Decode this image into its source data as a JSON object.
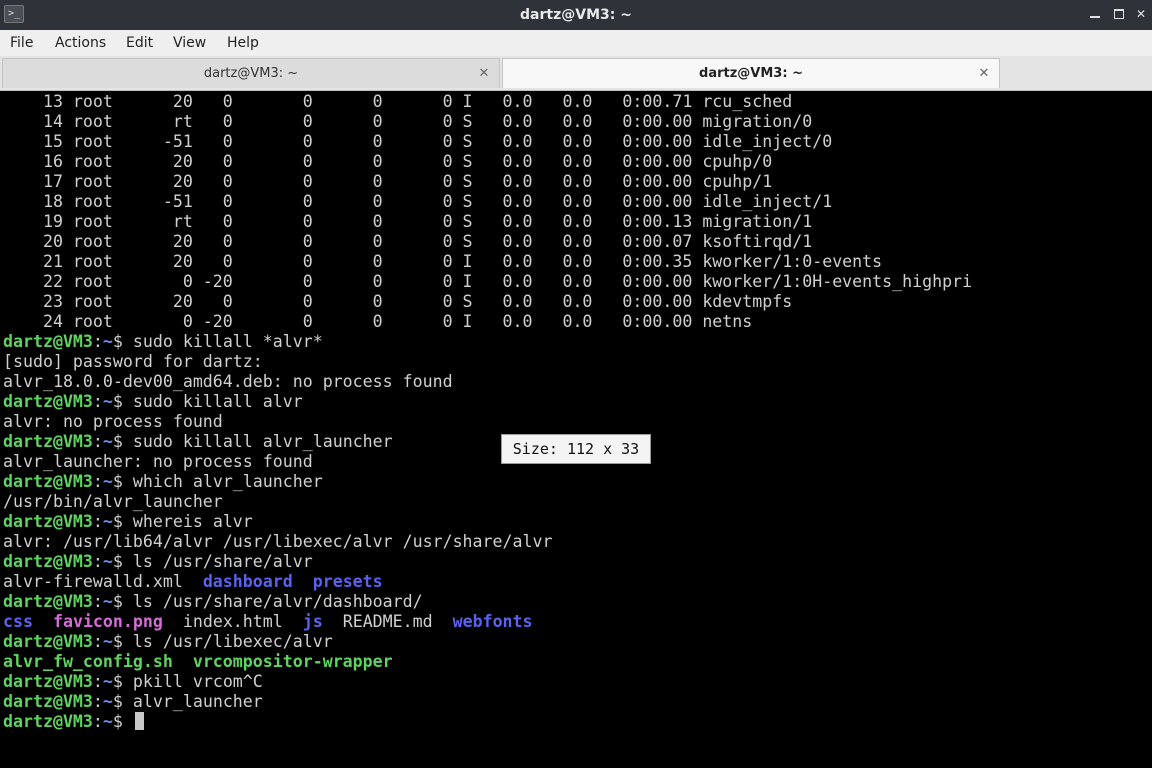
{
  "window": {
    "title": "dartz@VM3: ~",
    "app_icon": ">_"
  },
  "menu": {
    "items": [
      "File",
      "Actions",
      "Edit",
      "View",
      "Help"
    ]
  },
  "tabs": [
    {
      "label": "dartz@VM3: ~",
      "active": false
    },
    {
      "label": "dartz@VM3: ~",
      "active": true
    }
  ],
  "terminal": {
    "size_tooltip": "Size: 112 x 33",
    "lines": [
      [
        {
          "t": "    13 root      20   0       0      0      0 I   0.0   0.0   0:00.71 rcu_sched",
          "c": "white"
        }
      ],
      [
        {
          "t": "    14 root      rt   0       0      0      0 S   0.0   0.0   0:00.00 migration/0",
          "c": "white"
        }
      ],
      [
        {
          "t": "    15 root     -51   0       0      0      0 S   0.0   0.0   0:00.00 idle_inject/0",
          "c": "white"
        }
      ],
      [
        {
          "t": "    16 root      20   0       0      0      0 S   0.0   0.0   0:00.00 cpuhp/0",
          "c": "white"
        }
      ],
      [
        {
          "t": "    17 root      20   0       0      0      0 S   0.0   0.0   0:00.00 cpuhp/1",
          "c": "white"
        }
      ],
      [
        {
          "t": "    18 root     -51   0       0      0      0 S   0.0   0.0   0:00.00 idle_inject/1",
          "c": "white"
        }
      ],
      [
        {
          "t": "    19 root      rt   0       0      0      0 S   0.0   0.0   0:00.13 migration/1",
          "c": "white"
        }
      ],
      [
        {
          "t": "    20 root      20   0       0      0      0 S   0.0   0.0   0:00.07 ksoftirqd/1",
          "c": "white"
        }
      ],
      [
        {
          "t": "    21 root      20   0       0      0      0 I   0.0   0.0   0:00.35 kworker/1:0-events",
          "c": "white"
        }
      ],
      [
        {
          "t": "    22 root       0 -20       0      0      0 I   0.0   0.0   0:00.00 kworker/1:0H-events_highpri",
          "c": "white"
        }
      ],
      [
        {
          "t": "    23 root      20   0       0      0      0 S   0.0   0.0   0:00.00 kdevtmpfs",
          "c": "white"
        }
      ],
      [
        {
          "t": "    24 root       0 -20       0      0      0 I   0.0   0.0   0:00.00 netns",
          "c": "white"
        }
      ],
      [
        {
          "t": "dartz@VM3",
          "c": "green"
        },
        {
          "t": ":",
          "c": "white"
        },
        {
          "t": "~",
          "c": "blue"
        },
        {
          "t": "$ sudo killall *alvr*",
          "c": "white"
        }
      ],
      [
        {
          "t": "[sudo] password for dartz:",
          "c": "white"
        }
      ],
      [
        {
          "t": "alvr_18.0.0-dev00_amd64.deb: no process found",
          "c": "white"
        }
      ],
      [
        {
          "t": "dartz@VM3",
          "c": "green"
        },
        {
          "t": ":",
          "c": "white"
        },
        {
          "t": "~",
          "c": "blue"
        },
        {
          "t": "$ sudo killall alvr",
          "c": "white"
        }
      ],
      [
        {
          "t": "alvr: no process found",
          "c": "white"
        }
      ],
      [
        {
          "t": "dartz@VM3",
          "c": "green"
        },
        {
          "t": ":",
          "c": "white"
        },
        {
          "t": "~",
          "c": "blue"
        },
        {
          "t": "$ sudo killall alvr_launcher",
          "c": "white"
        }
      ],
      [
        {
          "t": "alvr_launcher: no process found",
          "c": "white"
        }
      ],
      [
        {
          "t": "dartz@VM3",
          "c": "green"
        },
        {
          "t": ":",
          "c": "white"
        },
        {
          "t": "~",
          "c": "blue"
        },
        {
          "t": "$ which alvr_launcher",
          "c": "white"
        }
      ],
      [
        {
          "t": "/usr/bin/alvr_launcher",
          "c": "white"
        }
      ],
      [
        {
          "t": "dartz@VM3",
          "c": "green"
        },
        {
          "t": ":",
          "c": "white"
        },
        {
          "t": "~",
          "c": "blue"
        },
        {
          "t": "$ whereis alvr",
          "c": "white"
        }
      ],
      [
        {
          "t": "alvr: /usr/lib64/alvr /usr/libexec/alvr /usr/share/alvr",
          "c": "white"
        }
      ],
      [
        {
          "t": "dartz@VM3",
          "c": "green"
        },
        {
          "t": ":",
          "c": "white"
        },
        {
          "t": "~",
          "c": "blue"
        },
        {
          "t": "$ ls /usr/share/alvr",
          "c": "white"
        }
      ],
      [
        {
          "t": "alvr-firewalld.xml  ",
          "c": "white"
        },
        {
          "t": "dashboard",
          "c": "dirblue"
        },
        {
          "t": "  ",
          "c": "white"
        },
        {
          "t": "presets",
          "c": "dirblue"
        }
      ],
      [
        {
          "t": "dartz@VM3",
          "c": "green"
        },
        {
          "t": ":",
          "c": "white"
        },
        {
          "t": "~",
          "c": "blue"
        },
        {
          "t": "$ ls /usr/share/alvr/dashboard/",
          "c": "white"
        }
      ],
      [
        {
          "t": "css",
          "c": "dirblue"
        },
        {
          "t": "  ",
          "c": "white"
        },
        {
          "t": "favicon.png",
          "c": "magenta"
        },
        {
          "t": "  index.html  ",
          "c": "white"
        },
        {
          "t": "js",
          "c": "dirblue"
        },
        {
          "t": "  README.md  ",
          "c": "white"
        },
        {
          "t": "webfonts",
          "c": "dirblue"
        }
      ],
      [
        {
          "t": "dartz@VM3",
          "c": "green"
        },
        {
          "t": ":",
          "c": "white"
        },
        {
          "t": "~",
          "c": "blue"
        },
        {
          "t": "$ ls /usr/libexec/alvr",
          "c": "white"
        }
      ],
      [
        {
          "t": "alvr_fw_config.sh",
          "c": "exe"
        },
        {
          "t": "  ",
          "c": "white"
        },
        {
          "t": "vrcompositor-wrapper",
          "c": "exe"
        }
      ],
      [
        {
          "t": "dartz@VM3",
          "c": "green"
        },
        {
          "t": ":",
          "c": "white"
        },
        {
          "t": "~",
          "c": "blue"
        },
        {
          "t": "$ pkill vrcom^C",
          "c": "white"
        }
      ],
      [
        {
          "t": "dartz@VM3",
          "c": "green"
        },
        {
          "t": ":",
          "c": "white"
        },
        {
          "t": "~",
          "c": "blue"
        },
        {
          "t": "$ alvr_launcher",
          "c": "white"
        }
      ],
      [
        {
          "t": "dartz@VM3",
          "c": "green"
        },
        {
          "t": ":",
          "c": "white"
        },
        {
          "t": "~",
          "c": "blue"
        },
        {
          "t": "$ ",
          "c": "white"
        }
      ]
    ]
  }
}
